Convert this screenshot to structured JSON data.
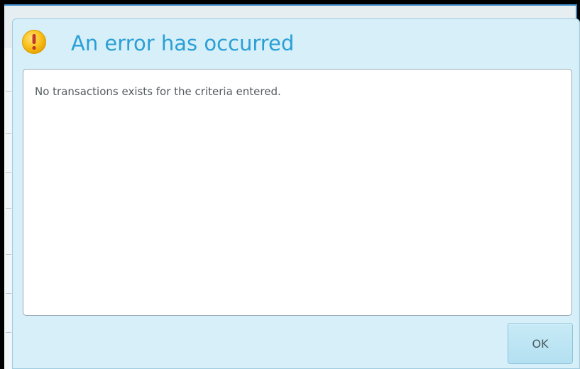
{
  "dialog": {
    "title": "An error has occurred",
    "icon": "warning-icon",
    "message": "No transactions exists for the criteria entered.",
    "ok_label": "OK"
  },
  "colors": {
    "title": "#2a9fd6",
    "dialog_background": "#d6eff8",
    "icon_fill": "#f7b500",
    "button_background": "#b3e0f1"
  }
}
